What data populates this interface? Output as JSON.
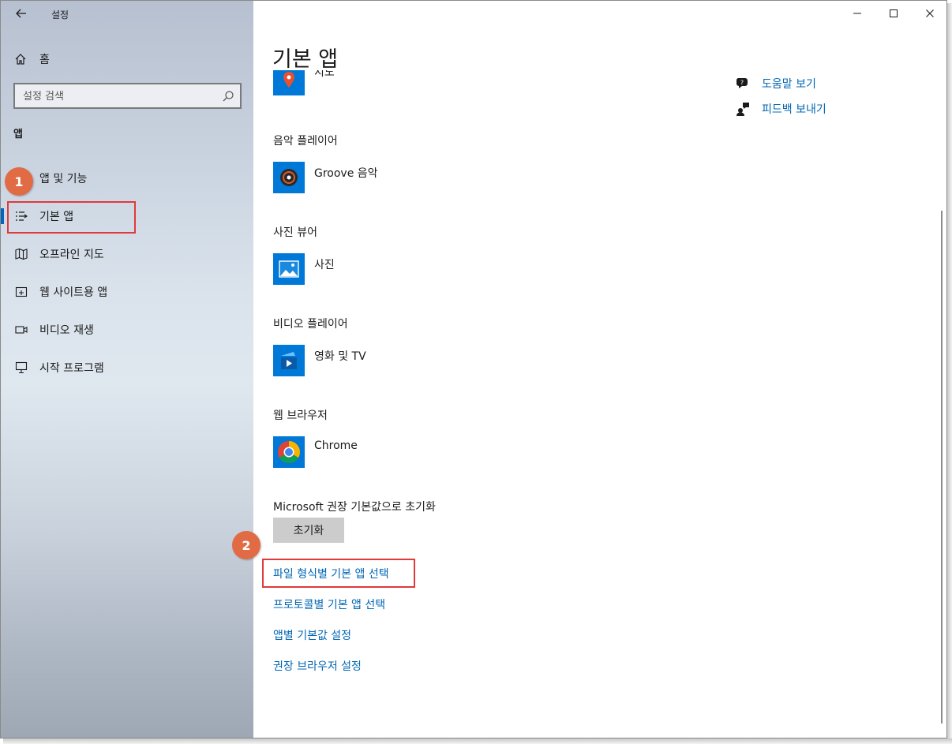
{
  "window": {
    "title": "설정",
    "controls": {
      "minimize": "—",
      "maximize": "☐",
      "close": "✕"
    }
  },
  "sidebar": {
    "home_label": "홈",
    "search_placeholder": "설정 검색",
    "section_title": "앱",
    "items": [
      {
        "label": "앱 및 기능",
        "icon": "apps-features-icon"
      },
      {
        "label": "기본 앱",
        "icon": "default-apps-icon",
        "active": true
      },
      {
        "label": "오프라인 지도",
        "icon": "offline-maps-icon"
      },
      {
        "label": "웹 사이트용 앱",
        "icon": "apps-for-websites-icon"
      },
      {
        "label": "비디오 재생",
        "icon": "video-playback-icon"
      },
      {
        "label": "시작 프로그램",
        "icon": "startup-icon"
      }
    ]
  },
  "main": {
    "title": "기본 앱",
    "partial_top_app": "지도",
    "categories": [
      {
        "label": "음악 플레이어",
        "app": "Groove 음악",
        "icon": "groove-music-icon"
      },
      {
        "label": "사진 뷰어",
        "app": "사진",
        "icon": "photos-icon"
      },
      {
        "label": "비디오 플레이어",
        "app": "영화 및 TV",
        "icon": "movies-tv-icon"
      },
      {
        "label": "웹 브라우저",
        "app": "Chrome",
        "icon": "chrome-icon"
      }
    ],
    "reset_label": "Microsoft 권장 기본값으로 초기화",
    "reset_button": "초기화",
    "links": [
      "파일 형식별 기본 앱 선택",
      "프로토콜별 기본 앱 선택",
      "앱별 기본값 설정",
      "권장 브라우저 설정"
    ]
  },
  "right_links": [
    {
      "label": "도움말 보기",
      "icon": "help-icon"
    },
    {
      "label": "피드백 보내기",
      "icon": "feedback-icon"
    }
  ],
  "annotations": {
    "badge1": "1",
    "badge2": "2"
  },
  "colors": {
    "accent": "#0078d7",
    "link": "#0066b4",
    "highlight": "#e03a3a",
    "badge": "#e06b45"
  }
}
